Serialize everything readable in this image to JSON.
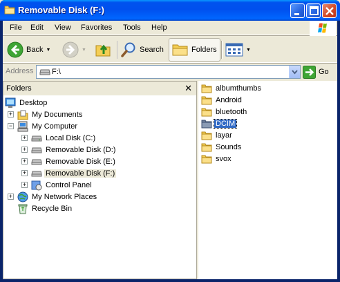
{
  "window": {
    "title": "Removable Disk (F:)"
  },
  "menu": [
    "File",
    "Edit",
    "View",
    "Favorites",
    "Tools",
    "Help"
  ],
  "toolbar": {
    "back_label": "Back",
    "search_label": "Search",
    "folders_label": "Folders"
  },
  "address": {
    "label": "Address",
    "value": "F:\\",
    "go_label": "Go"
  },
  "folders_pane": {
    "title": "Folders",
    "close_glyph": "✕",
    "tree": [
      {
        "label": "Desktop",
        "icon": "desktop-icon",
        "expander": ""
      },
      {
        "label": "My Documents",
        "icon": "my-documents-icon",
        "expander": "+"
      },
      {
        "label": "My Computer",
        "icon": "my-computer-icon",
        "expander": "−"
      },
      {
        "label": "Local Disk (C:)",
        "icon": "local-disk-icon",
        "expander": "+"
      },
      {
        "label": "Removable Disk (D:)",
        "icon": "removable-disk-icon",
        "expander": "+"
      },
      {
        "label": "Removable Disk (E:)",
        "icon": "removable-disk-icon",
        "expander": "+"
      },
      {
        "label": "Removable Disk (F:)",
        "icon": "removable-disk-icon",
        "expander": "+",
        "selected": true
      },
      {
        "label": "Control Panel",
        "icon": "control-panel-icon",
        "expander": "+"
      },
      {
        "label": "My Network Places",
        "icon": "network-places-icon",
        "expander": "+"
      },
      {
        "label": "Recycle Bin",
        "icon": "recycle-bin-icon",
        "expander": ""
      }
    ]
  },
  "files": [
    {
      "name": "albumthumbs",
      "icon": "folder-icon"
    },
    {
      "name": "Android",
      "icon": "folder-icon"
    },
    {
      "name": "bluetooth",
      "icon": "folder-icon"
    },
    {
      "name": "DCIM",
      "icon": "folder-icon",
      "selected": true
    },
    {
      "name": "layar",
      "icon": "folder-icon"
    },
    {
      "name": "Sounds",
      "icon": "folder-icon"
    },
    {
      "name": "svox",
      "icon": "folder-icon"
    }
  ],
  "colors": {
    "titlebar": "#0054E3",
    "selection": "#316AC5",
    "window_bg": "#ECE9D8"
  }
}
